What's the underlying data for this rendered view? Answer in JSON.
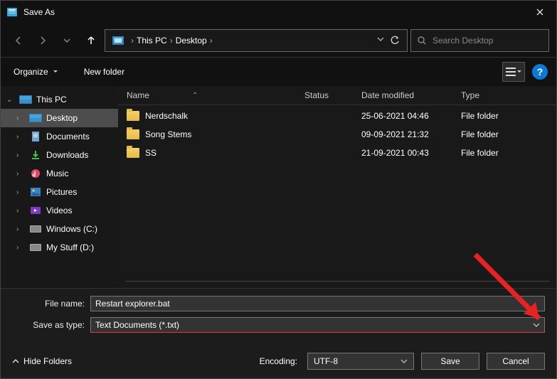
{
  "window": {
    "title": "Save As"
  },
  "nav": {
    "breadcrumb": {
      "root": "This PC",
      "current": "Desktop"
    },
    "search_placeholder": "Search Desktop"
  },
  "toolbar": {
    "organize": "Organize",
    "new_folder": "New folder"
  },
  "sidebar": {
    "root": "This PC",
    "items": [
      {
        "label": "Desktop",
        "selected": true,
        "icon": "folder"
      },
      {
        "label": "Documents",
        "icon": "folder"
      },
      {
        "label": "Downloads",
        "icon": "download"
      },
      {
        "label": "Music",
        "icon": "music"
      },
      {
        "label": "Pictures",
        "icon": "pictures"
      },
      {
        "label": "Videos",
        "icon": "video"
      },
      {
        "label": "Windows (C:)",
        "icon": "disk"
      },
      {
        "label": "My Stuff (D:)",
        "icon": "disk"
      }
    ]
  },
  "columns": {
    "name": "Name",
    "status": "Status",
    "date": "Date modified",
    "type": "Type"
  },
  "rows": [
    {
      "name": "Nerdschalk",
      "date": "25-06-2021 04:46",
      "type": "File folder"
    },
    {
      "name": "Song Stems",
      "date": "09-09-2021 21:32",
      "type": "File folder"
    },
    {
      "name": "SS",
      "date": "21-09-2021 00:43",
      "type": "File folder"
    }
  ],
  "form": {
    "filename_label": "File name:",
    "filename_value": "Restart explorer.bat",
    "type_label": "Save as type:",
    "type_value": "Text Documents (*.txt)"
  },
  "footer": {
    "hide_folders": "Hide Folders",
    "encoding_label": "Encoding:",
    "encoding_value": "UTF-8",
    "save": "Save",
    "cancel": "Cancel"
  }
}
